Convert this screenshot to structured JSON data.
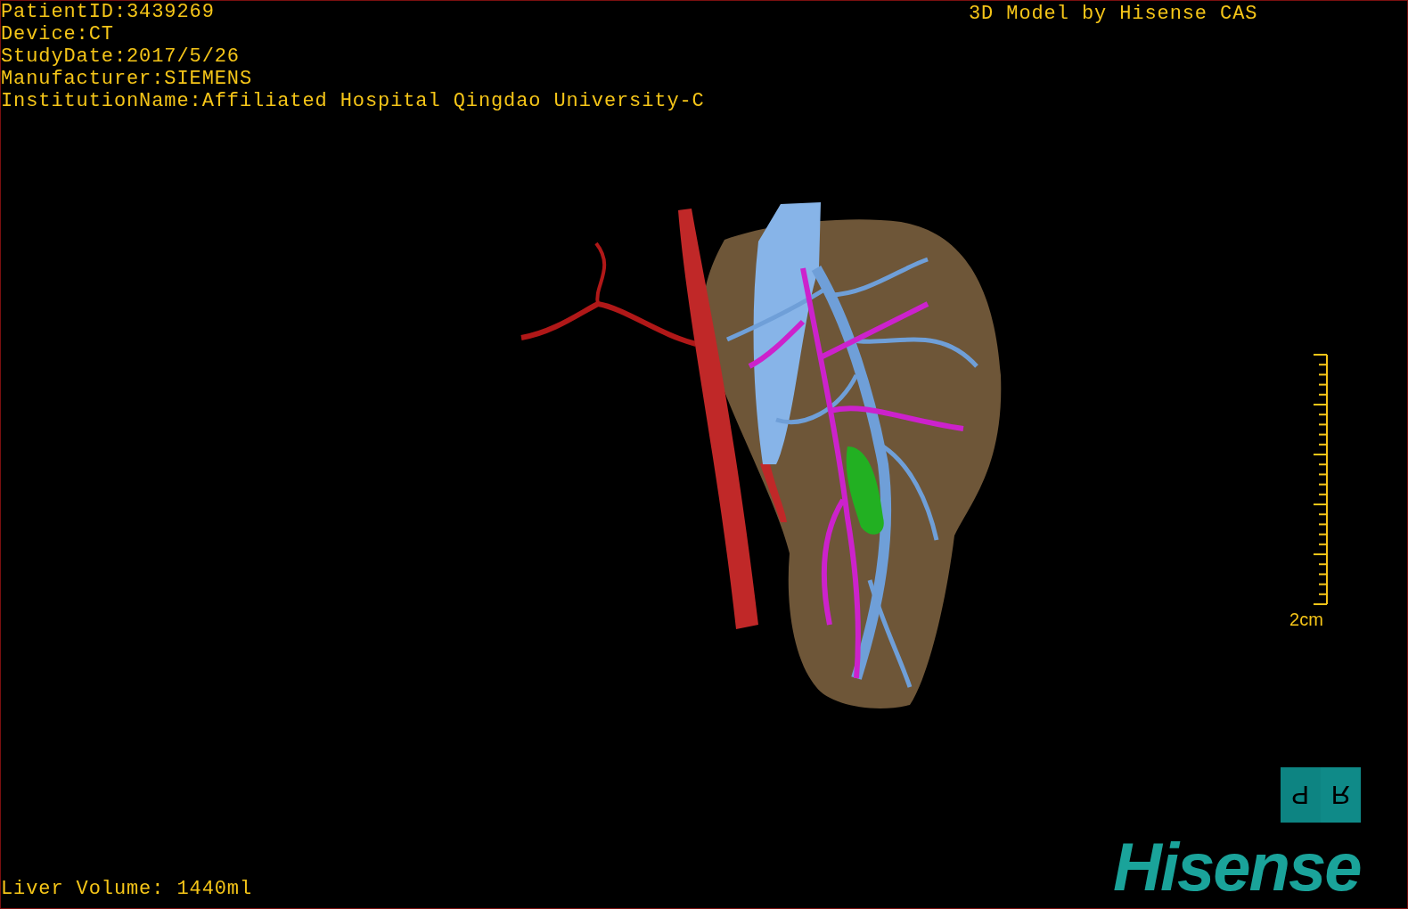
{
  "patient_info": [
    "PatientID:3439269",
    "Device:CT",
    "StudyDate:2017/5/26",
    "Manufacturer:SIEMENS",
    "InstitutionName:Affiliated Hospital Qingdao University-C"
  ],
  "model_credit": "3D Model by Hisense CAS",
  "scale_bar": {
    "label": "2cm"
  },
  "orientation_cube": {
    "faces": [
      {
        "kind": "rotated",
        "letter": "P"
      },
      {
        "kind": "flipped",
        "letter": "R"
      }
    ]
  },
  "logo": "Hisense",
  "liver_volume": "Liver Volume: 1440ml"
}
